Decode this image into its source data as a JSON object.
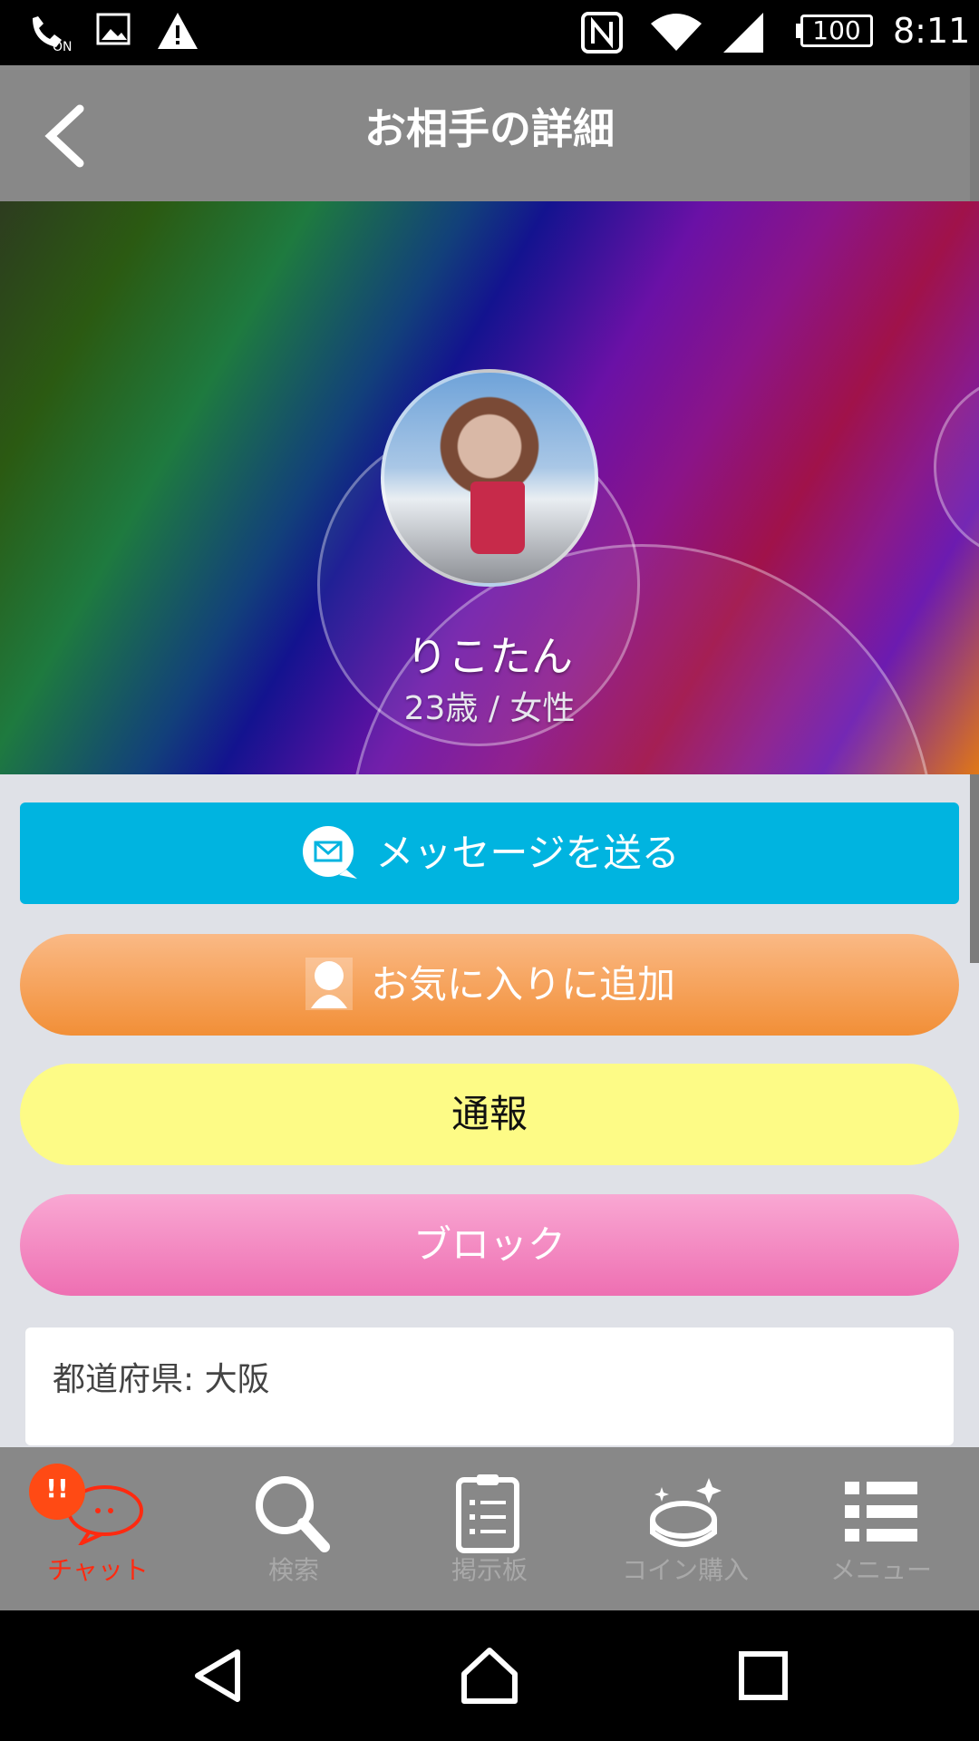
{
  "status_bar": {
    "battery": "100",
    "time": "8:11",
    "icons": [
      "call-on-icon",
      "image-icon",
      "warning-icon",
      "nfc-icon",
      "wifi-icon",
      "signal-icon",
      "battery-icon"
    ]
  },
  "header": {
    "title": "お相手の詳細",
    "back_icon": "chevron-left-icon"
  },
  "profile": {
    "name": "りこたん",
    "age_gender": "23歳 / 女性"
  },
  "actions": {
    "message": "メッセージを送る",
    "favorite": "お気に入りに追加",
    "report": "通報",
    "block": "ブロック"
  },
  "info": {
    "prefecture": "都道府県: 大阪"
  },
  "bottom_nav": {
    "items": [
      {
        "label": "チャット",
        "icon": "chat-icon",
        "active": true,
        "badge": "!!"
      },
      {
        "label": "検索",
        "icon": "search-icon"
      },
      {
        "label": "掲示板",
        "icon": "clipboard-icon"
      },
      {
        "label": "コイン購入",
        "icon": "coin-icon"
      },
      {
        "label": "メニュー",
        "icon": "menu-icon"
      }
    ]
  },
  "colors": {
    "header_bg": "#888888",
    "message_button": "#00b4e0",
    "favorite_button": "#f28f37",
    "report_button": "#fdfb86",
    "block_button": "#ee6fb2",
    "active_nav": "#ff2a10"
  }
}
